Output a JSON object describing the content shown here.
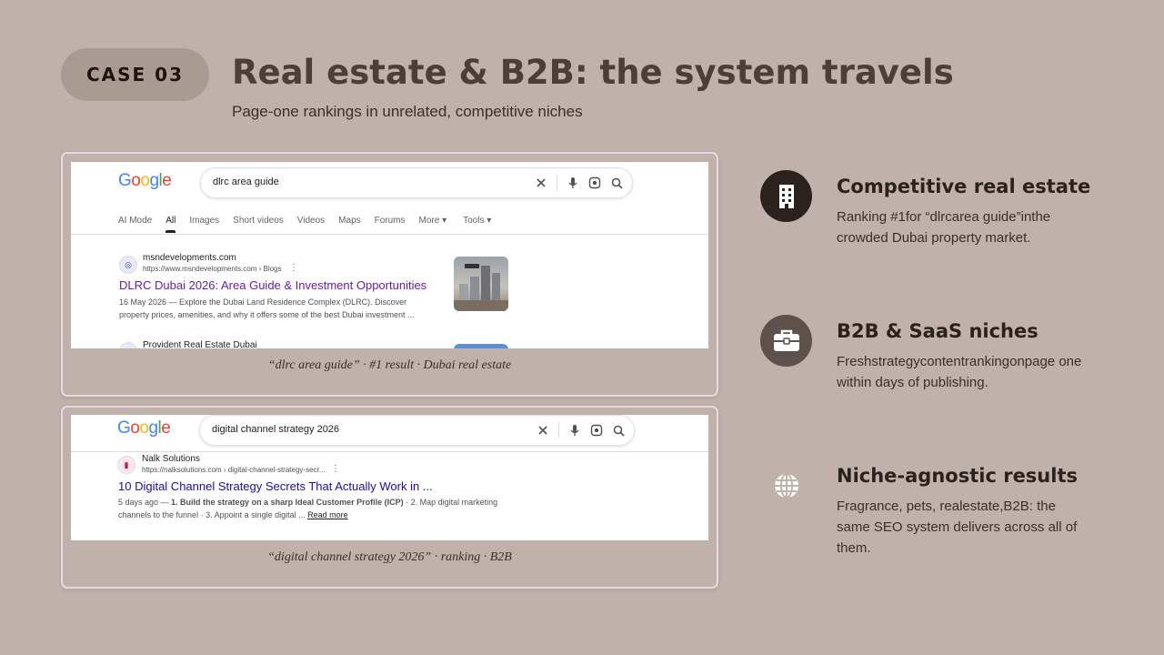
{
  "header": {
    "badge": "CASE 03",
    "title": "Real estate & B2B: the system travels",
    "subtitle": "Page-one rankings in unrelated, competitive niches"
  },
  "card1": {
    "logo": [
      "G",
      "o",
      "o",
      "g",
      "l",
      "e"
    ],
    "query": "dlrc area guide",
    "tabs": [
      "AI Mode",
      "All",
      "Images",
      "Short videos",
      "Videos",
      "Maps",
      "Forums",
      "More ▾",
      "Tools ▾"
    ],
    "active_tab": "All",
    "result": {
      "site": "msndevelopments.com",
      "url": "https://www.msndevelopments.com › Blogs",
      "title": "DLRC Dubai 2026: Area Guide & Investment Opportunities",
      "snippet": "16 May 2026 — Explore the Dubai Land Residence Complex (DLRC). Discover property prices, amenities, and why it offers some of the best Dubai investment ..."
    },
    "next_site": "Provident Real Estate Dubai",
    "caption": "“dlrc area guide” · #1 result · Dubai real estate"
  },
  "card2": {
    "logo": [
      "G",
      "o",
      "o",
      "g",
      "l",
      "e"
    ],
    "query": "digital channel strategy 2026",
    "result": {
      "site": "Nalk Solutions",
      "url": "https://nalksolutions.com › digital-channel-strategy-secr...",
      "title": "10 Digital Channel Strategy Secrets That Actually Work in ...",
      "snippet_prefix": "5 days ago — ",
      "snippet_bold": "1. Build the strategy on a sharp Ideal Customer Profile (ICP)",
      "snippet_rest": " · 2. Map digital marketing channels to the funnel · 3. Appoint a single digital ... ",
      "read_more": "Read more"
    },
    "caption": "“digital channel strategy 2026” · ranking · B2B"
  },
  "features": [
    {
      "icon": "building-icon",
      "title": "Competitive real estate",
      "desc": "Ranking #1for “dlrcarea guide”inthe crowded Dubai property market."
    },
    {
      "icon": "briefcase-icon",
      "title": "B2B & SaaS niches",
      "desc": "Freshstrategycontentrankingonpage one within days of publishing."
    },
    {
      "icon": "globe-icon",
      "title": "Niche-agnostic results",
      "desc": "Fragrance, pets, realestate,B2B: the same SEO system delivers across all of them."
    }
  ],
  "colors": {
    "background": "#c0b2aa",
    "badge": "#a99a92",
    "title": "#4b3f38",
    "link_visited": "#681da8",
    "link": "#1a0dab",
    "google_blue": "#4285f4",
    "google_red": "#ea4335",
    "google_yellow": "#fbbc05",
    "google_green": "#34a853"
  }
}
